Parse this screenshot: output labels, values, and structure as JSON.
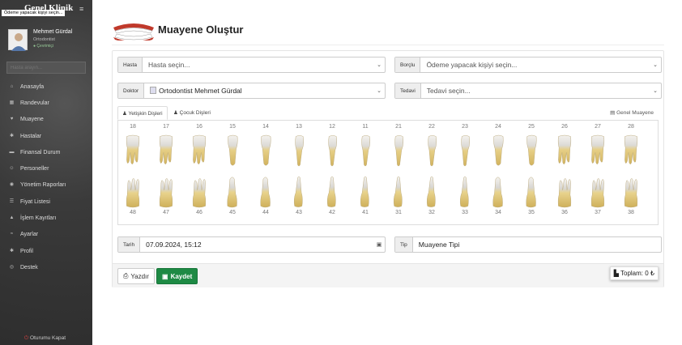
{
  "brand": {
    "logo_text": "Genel Klinik",
    "tooltip": "Ödeme yapacak kişiyi seçin..."
  },
  "user": {
    "name": "Mehmet Gürdal",
    "role": "Ortodontist",
    "status": "Çevrimiçi"
  },
  "sidebar": {
    "search_placeholder": "Hasta arayın...",
    "items": [
      {
        "label": "Anasayfa",
        "icon": "home-icon",
        "glyph": "⌂"
      },
      {
        "label": "Randevular",
        "icon": "calendar-icon",
        "glyph": "▦"
      },
      {
        "label": "Muayene",
        "icon": "tooth-icon",
        "glyph": "♥"
      },
      {
        "label": "Hastalar",
        "icon": "gear-icon",
        "glyph": "✱"
      },
      {
        "label": "Finansal Durum",
        "icon": "chart-icon",
        "glyph": "▬"
      },
      {
        "label": "Personeller",
        "icon": "users-icon",
        "glyph": "☺"
      },
      {
        "label": "Yönetim Raporları",
        "icon": "report-icon",
        "glyph": "◉"
      },
      {
        "label": "Fiyat Listesi",
        "icon": "list-icon",
        "glyph": "☰"
      },
      {
        "label": "İşlem Kayıtları",
        "icon": "log-icon",
        "glyph": "▲"
      },
      {
        "label": "Ayarlar",
        "icon": "sliders-icon",
        "glyph": "≈"
      },
      {
        "label": "Profil",
        "icon": "profile-icon",
        "glyph": "✱"
      },
      {
        "label": "Destek",
        "icon": "support-icon",
        "glyph": "◎"
      }
    ],
    "logout": "Oturumu Kapat"
  },
  "page": {
    "title": "Muayene Oluştur"
  },
  "form": {
    "hasta": {
      "label": "Hasta",
      "value": "Hasta seçin..."
    },
    "borclu": {
      "label": "Borçlu",
      "value": "Ödeme yapacak kişiyi seçin..."
    },
    "doktor": {
      "label": "Doktor",
      "value": "Ortodontist Mehmet Gürdal"
    },
    "tedavi": {
      "label": "Tedavi",
      "value": "Tedavi seçin..."
    },
    "tarih": {
      "label": "Tarih",
      "value": "07.09.2024, 15:12"
    },
    "tip": {
      "label": "Tip",
      "value": "Muayene Tipi"
    }
  },
  "tabs": {
    "adult": "Yetişkin Dişleri",
    "child": "Çocuk Dişleri",
    "general": "Genel Muayene"
  },
  "teeth": {
    "upper": [
      "18",
      "17",
      "16",
      "15",
      "14",
      "13",
      "12",
      "11",
      "21",
      "22",
      "23",
      "24",
      "25",
      "26",
      "27",
      "28"
    ],
    "lower": [
      "48",
      "47",
      "46",
      "45",
      "44",
      "43",
      "42",
      "41",
      "31",
      "32",
      "33",
      "34",
      "35",
      "36",
      "37",
      "38"
    ]
  },
  "buttons": {
    "print": "Yazdır",
    "save": "Kaydet"
  },
  "total": {
    "label": "Toplam: 0 ₺"
  },
  "colors": {
    "save": "#1e8a44",
    "sidebar": "#3a3a3a",
    "tooth_root": "#e0c98a",
    "tooth_crown": "#f2f2f2"
  }
}
